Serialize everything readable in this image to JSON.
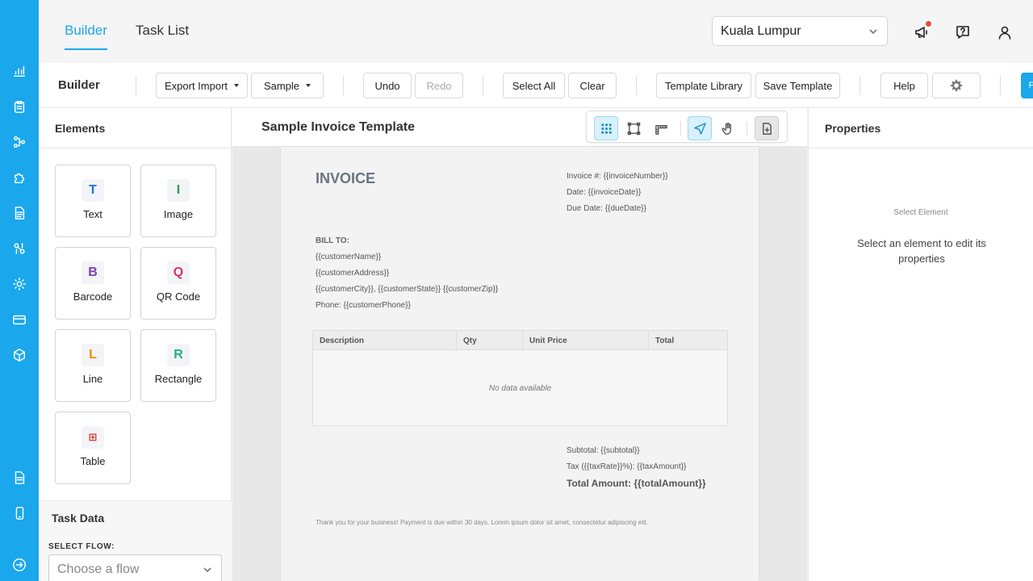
{
  "header": {
    "tabs": [
      {
        "label": "Builder",
        "active": true
      },
      {
        "label": "Task List",
        "active": false
      }
    ],
    "location": "Kuala Lumpur"
  },
  "toolbar": {
    "title": "Builder",
    "export_import": "Export Import",
    "sample": "Sample",
    "undo": "Undo",
    "redo": "Redo",
    "select_all": "Select All",
    "clear": "Clear",
    "template_library": "Template Library",
    "save_template": "Save Template",
    "help": "Help",
    "primary_partial": "P"
  },
  "elements_panel": {
    "title": "Elements",
    "items": [
      {
        "glyph": "T",
        "label": "Text",
        "color": "#1a73e8"
      },
      {
        "glyph": "I",
        "label": "Image",
        "color": "#2e9e4f"
      },
      {
        "glyph": "B",
        "label": "Barcode",
        "color": "#7b3fb5"
      },
      {
        "glyph": "Q",
        "label": "QR Code",
        "color": "#d6336c"
      },
      {
        "glyph": "L",
        "label": "Line",
        "color": "#f08c00"
      },
      {
        "glyph": "R",
        "label": "Rectangle",
        "color": "#20b27a"
      },
      {
        "glyph": "⊞",
        "label": "Table",
        "color": "#e03131"
      }
    ]
  },
  "task_data": {
    "title": "Task Data",
    "select_flow_label": "SELECT FLOW:",
    "flow_placeholder": "Choose a flow"
  },
  "canvas": {
    "title": "Sample Invoice Template"
  },
  "invoice": {
    "title": "INVOICE",
    "number": "Invoice #: {{invoiceNumber}}",
    "date": "Date: {{invoiceDate}}",
    "due": "Due Date: {{dueDate}}",
    "bill_to": "BILL TO:",
    "customer_name": "{{customerName}}",
    "customer_address": "{{customerAddress}}",
    "customer_city": "{{customerCity}}, {{customerState}} {{customerZip}}",
    "phone": "Phone: {{customerPhone}}",
    "table_headers": [
      "Description",
      "Qty",
      "Unit Price",
      "Total"
    ],
    "empty_text": "No data available",
    "subtotal": "Subtotal: {{subtotal}}",
    "tax": "Tax ({{taxRate}}%): {{taxAmount}}",
    "total": "Total Amount: {{totalAmount}}",
    "footnote": "Thank you for your business! Payment is due within 30 days. Lorem ipsum dolor sit amet, consectetur adipiscing elit."
  },
  "properties": {
    "title": "Properties",
    "select_small": "Select Element",
    "select_text": "Select an element to edit its properties"
  },
  "colors": {
    "accent": "#1aa7ec",
    "notification": "#e74c3c"
  }
}
